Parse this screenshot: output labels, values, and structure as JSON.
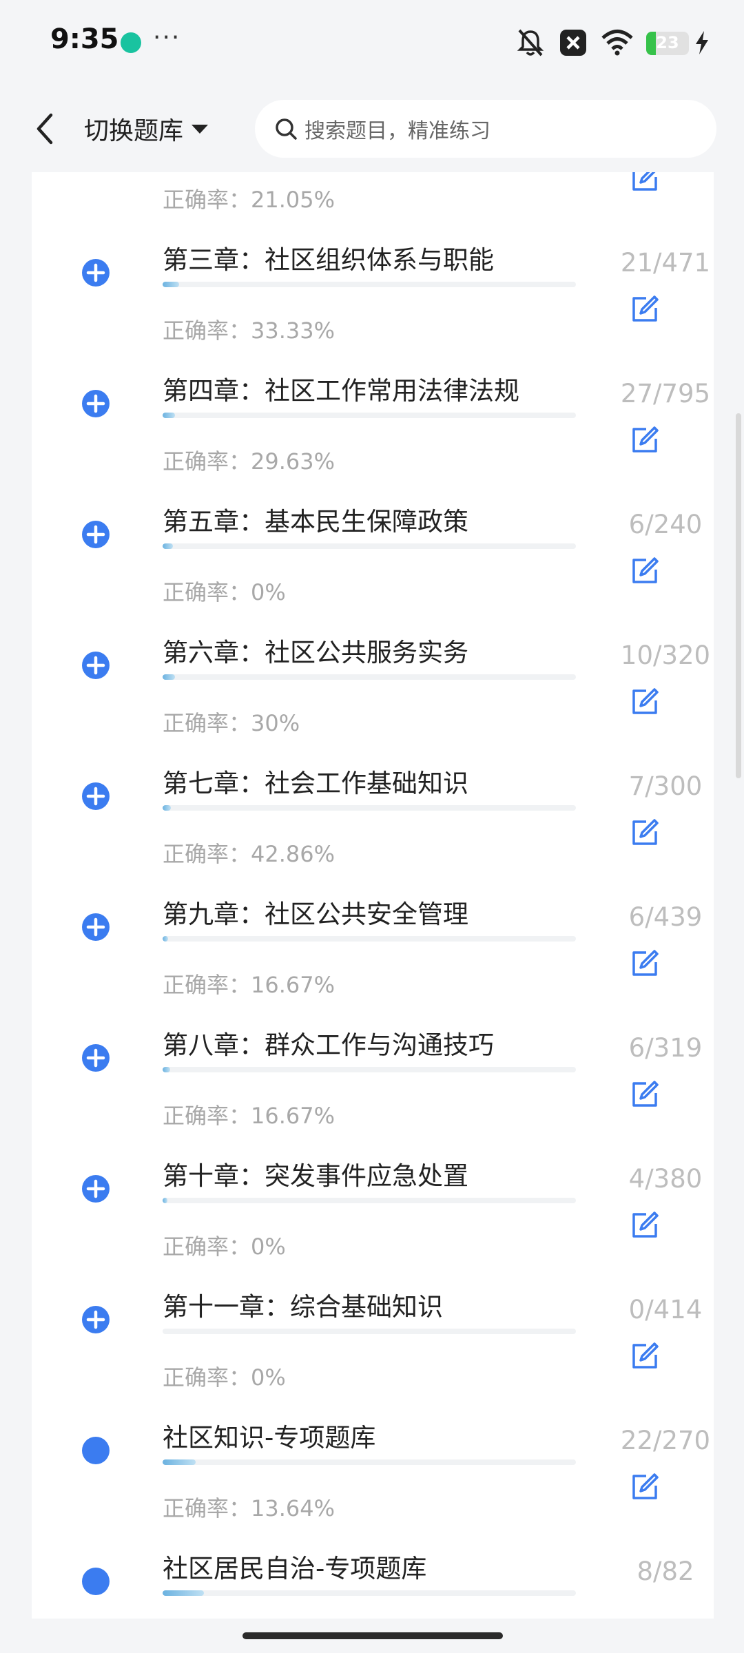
{
  "status": {
    "time": "9:35",
    "dots": "···",
    "battery": "23"
  },
  "header": {
    "switch_label": "切换题库",
    "search_placeholder": "搜索题目，精准练习"
  },
  "chapters": [
    {
      "title": "",
      "count": "",
      "accuracy": "正确率：21.05%",
      "progress": 0.07
    },
    {
      "title": "第三章：社区组织体系与职能",
      "count": "21/471",
      "accuracy": "正确率：33.33%",
      "progress": 0.04
    },
    {
      "title": "第四章：社区工作常用法律法规",
      "count": "27/795",
      "accuracy": "正确率：29.63%",
      "progress": 0.03
    },
    {
      "title": "第五章：基本民生保障政策",
      "count": "6/240",
      "accuracy": "正确率：0%",
      "progress": 0.025
    },
    {
      "title": "第六章：社区公共服务实务",
      "count": "10/320",
      "accuracy": "正确率：30%",
      "progress": 0.03
    },
    {
      "title": "第七章：社会工作基础知识",
      "count": "7/300",
      "accuracy": "正确率：42.86%",
      "progress": 0.02
    },
    {
      "title": "第九章：社区公共安全管理",
      "count": "6/439",
      "accuracy": "正确率：16.67%",
      "progress": 0.014
    },
    {
      "title": "第八章：群众工作与沟通技巧",
      "count": "6/319",
      "accuracy": "正确率：16.67%",
      "progress": 0.019
    },
    {
      "title": "第十章：突发事件应急处置",
      "count": "4/380",
      "accuracy": "正确率：0%",
      "progress": 0.011
    },
    {
      "title": "第十一章：综合基础知识",
      "count": "0/414",
      "accuracy": "正确率：0%",
      "progress": 0.0
    },
    {
      "title": "社区知识-专项题库",
      "count": "22/270",
      "accuracy": "正确率：13.64%",
      "progress": 0.08
    },
    {
      "title": "社区居民自治-专项题库",
      "count": "8/82",
      "accuracy": "",
      "progress": 0.1
    }
  ],
  "colors": {
    "accent": "#3b7cf0",
    "progress": "#6bb2e0",
    "muted_text": "#a8a8a8"
  }
}
